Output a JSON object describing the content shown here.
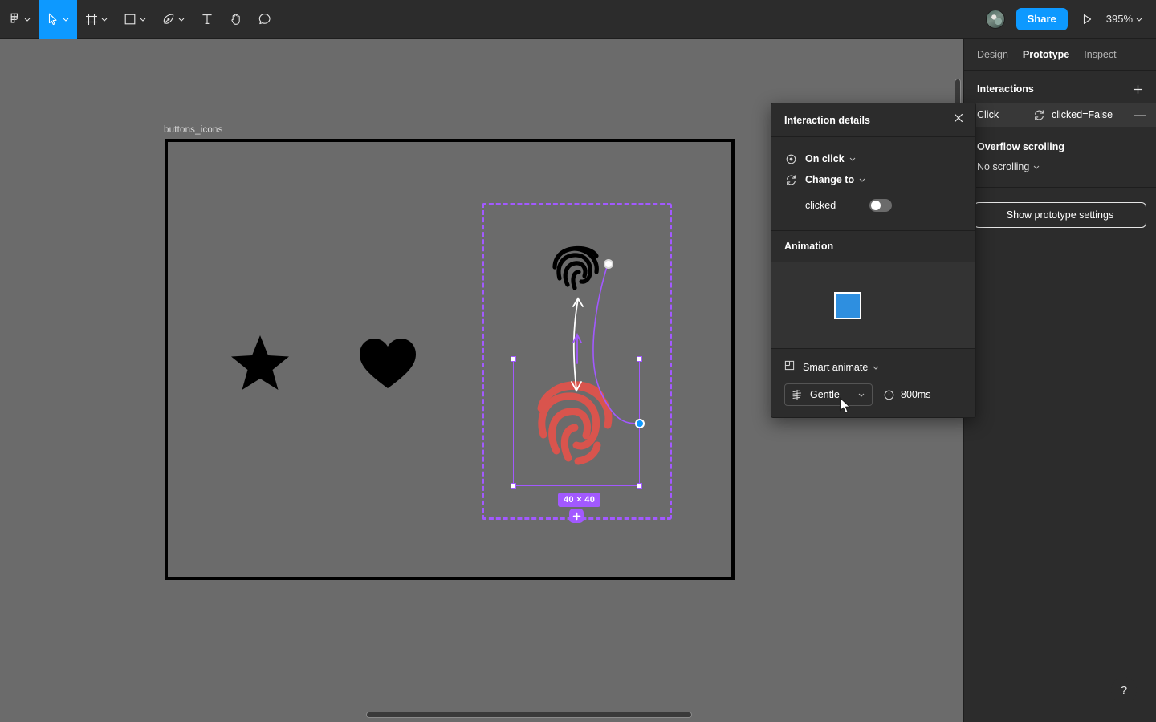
{
  "toolbar": {
    "tools": [
      {
        "name": "figma-menu",
        "icon": "figma-logo",
        "caret": true,
        "active": false
      },
      {
        "name": "move-tool",
        "icon": "cursor-arrow",
        "caret": true,
        "active": true
      },
      {
        "name": "frame-tool",
        "icon": "frame",
        "caret": true,
        "active": false
      },
      {
        "name": "shape-tool",
        "icon": "rectangle",
        "caret": true,
        "active": false
      },
      {
        "name": "pen-tool",
        "icon": "pen",
        "caret": true,
        "active": false
      },
      {
        "name": "text-tool",
        "icon": "text-t",
        "caret": false,
        "active": false
      },
      {
        "name": "hand-tool",
        "icon": "hand",
        "caret": false,
        "active": false
      },
      {
        "name": "comment-tool",
        "icon": "comment-bubble",
        "caret": false,
        "active": false
      }
    ],
    "share_label": "Share",
    "present_icon": "play-triangle",
    "zoom_level": "395%",
    "avatar_name": "user-avatar",
    "accent_color": "#0d99ff"
  },
  "canvas": {
    "frame_label": "buttons_icons",
    "background_color": "#6b6b6b",
    "frame_border_color": "#000000",
    "icons": [
      {
        "name": "star-icon",
        "color": "#000000"
      },
      {
        "name": "heart-icon",
        "color": "#000000"
      },
      {
        "name": "fingerprint-icon-default",
        "color": "#000000"
      },
      {
        "name": "fingerprint-icon-clicked",
        "color": "#d9544d"
      }
    ],
    "selection": {
      "dimension_badge": "40 × 40",
      "selection_color": "#a259ff",
      "add-interaction-label": "+"
    },
    "prototype_connector_color": "#a259ff",
    "scroll": {
      "vertical": "vertical-scrollbar",
      "horizontal": "horizontal-scrollbar"
    }
  },
  "right_panel": {
    "tabs": [
      {
        "label": "Design",
        "active": false
      },
      {
        "label": "Prototype",
        "active": true
      },
      {
        "label": "Inspect",
        "active": false
      }
    ],
    "interactions": {
      "title": "Interactions",
      "add_label": "+",
      "rows": [
        {
          "event": "Click",
          "target": "clicked=False",
          "remove_label": "—"
        }
      ]
    },
    "overflow": {
      "title": "Overflow scrolling",
      "value": "No scrolling"
    },
    "prototype_settings_label": "Show prototype settings"
  },
  "popup": {
    "title": "Interaction details",
    "close_label": "close-icon",
    "trigger": {
      "icon": "on-click-icon",
      "label": "On click"
    },
    "action": {
      "icon": "change-to-icon",
      "label": "Change to"
    },
    "variable": {
      "name": "clicked",
      "toggle_state": "off"
    },
    "animation": {
      "title": "Animation",
      "preview_color": "#2e8fe0",
      "type": "Smart animate",
      "easing": "Gentle",
      "duration": "800ms",
      "duration_icon": "clock-icon"
    }
  },
  "help": {
    "label": "?"
  }
}
